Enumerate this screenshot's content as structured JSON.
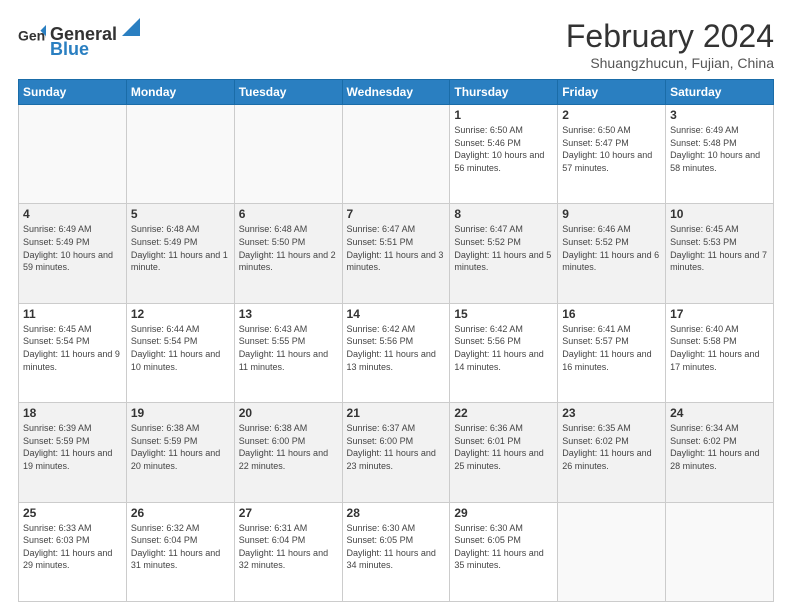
{
  "header": {
    "logo_general": "General",
    "logo_blue": "Blue",
    "title": "February 2024",
    "subtitle": "Shuangzhucun, Fujian, China"
  },
  "days_of_week": [
    "Sunday",
    "Monday",
    "Tuesday",
    "Wednesday",
    "Thursday",
    "Friday",
    "Saturday"
  ],
  "weeks": [
    [
      {
        "day": "",
        "info": ""
      },
      {
        "day": "",
        "info": ""
      },
      {
        "day": "",
        "info": ""
      },
      {
        "day": "",
        "info": ""
      },
      {
        "day": "1",
        "info": "Sunrise: 6:50 AM\nSunset: 5:46 PM\nDaylight: 10 hours and 56 minutes."
      },
      {
        "day": "2",
        "info": "Sunrise: 6:50 AM\nSunset: 5:47 PM\nDaylight: 10 hours and 57 minutes."
      },
      {
        "day": "3",
        "info": "Sunrise: 6:49 AM\nSunset: 5:48 PM\nDaylight: 10 hours and 58 minutes."
      }
    ],
    [
      {
        "day": "4",
        "info": "Sunrise: 6:49 AM\nSunset: 5:49 PM\nDaylight: 10 hours and 59 minutes."
      },
      {
        "day": "5",
        "info": "Sunrise: 6:48 AM\nSunset: 5:49 PM\nDaylight: 11 hours and 1 minute."
      },
      {
        "day": "6",
        "info": "Sunrise: 6:48 AM\nSunset: 5:50 PM\nDaylight: 11 hours and 2 minutes."
      },
      {
        "day": "7",
        "info": "Sunrise: 6:47 AM\nSunset: 5:51 PM\nDaylight: 11 hours and 3 minutes."
      },
      {
        "day": "8",
        "info": "Sunrise: 6:47 AM\nSunset: 5:52 PM\nDaylight: 11 hours and 5 minutes."
      },
      {
        "day": "9",
        "info": "Sunrise: 6:46 AM\nSunset: 5:52 PM\nDaylight: 11 hours and 6 minutes."
      },
      {
        "day": "10",
        "info": "Sunrise: 6:45 AM\nSunset: 5:53 PM\nDaylight: 11 hours and 7 minutes."
      }
    ],
    [
      {
        "day": "11",
        "info": "Sunrise: 6:45 AM\nSunset: 5:54 PM\nDaylight: 11 hours and 9 minutes."
      },
      {
        "day": "12",
        "info": "Sunrise: 6:44 AM\nSunset: 5:54 PM\nDaylight: 11 hours and 10 minutes."
      },
      {
        "day": "13",
        "info": "Sunrise: 6:43 AM\nSunset: 5:55 PM\nDaylight: 11 hours and 11 minutes."
      },
      {
        "day": "14",
        "info": "Sunrise: 6:42 AM\nSunset: 5:56 PM\nDaylight: 11 hours and 13 minutes."
      },
      {
        "day": "15",
        "info": "Sunrise: 6:42 AM\nSunset: 5:56 PM\nDaylight: 11 hours and 14 minutes."
      },
      {
        "day": "16",
        "info": "Sunrise: 6:41 AM\nSunset: 5:57 PM\nDaylight: 11 hours and 16 minutes."
      },
      {
        "day": "17",
        "info": "Sunrise: 6:40 AM\nSunset: 5:58 PM\nDaylight: 11 hours and 17 minutes."
      }
    ],
    [
      {
        "day": "18",
        "info": "Sunrise: 6:39 AM\nSunset: 5:59 PM\nDaylight: 11 hours and 19 minutes."
      },
      {
        "day": "19",
        "info": "Sunrise: 6:38 AM\nSunset: 5:59 PM\nDaylight: 11 hours and 20 minutes."
      },
      {
        "day": "20",
        "info": "Sunrise: 6:38 AM\nSunset: 6:00 PM\nDaylight: 11 hours and 22 minutes."
      },
      {
        "day": "21",
        "info": "Sunrise: 6:37 AM\nSunset: 6:00 PM\nDaylight: 11 hours and 23 minutes."
      },
      {
        "day": "22",
        "info": "Sunrise: 6:36 AM\nSunset: 6:01 PM\nDaylight: 11 hours and 25 minutes."
      },
      {
        "day": "23",
        "info": "Sunrise: 6:35 AM\nSunset: 6:02 PM\nDaylight: 11 hours and 26 minutes."
      },
      {
        "day": "24",
        "info": "Sunrise: 6:34 AM\nSunset: 6:02 PM\nDaylight: 11 hours and 28 minutes."
      }
    ],
    [
      {
        "day": "25",
        "info": "Sunrise: 6:33 AM\nSunset: 6:03 PM\nDaylight: 11 hours and 29 minutes."
      },
      {
        "day": "26",
        "info": "Sunrise: 6:32 AM\nSunset: 6:04 PM\nDaylight: 11 hours and 31 minutes."
      },
      {
        "day": "27",
        "info": "Sunrise: 6:31 AM\nSunset: 6:04 PM\nDaylight: 11 hours and 32 minutes."
      },
      {
        "day": "28",
        "info": "Sunrise: 6:30 AM\nSunset: 6:05 PM\nDaylight: 11 hours and 34 minutes."
      },
      {
        "day": "29",
        "info": "Sunrise: 6:30 AM\nSunset: 6:05 PM\nDaylight: 11 hours and 35 minutes."
      },
      {
        "day": "",
        "info": ""
      },
      {
        "day": "",
        "info": ""
      }
    ]
  ]
}
